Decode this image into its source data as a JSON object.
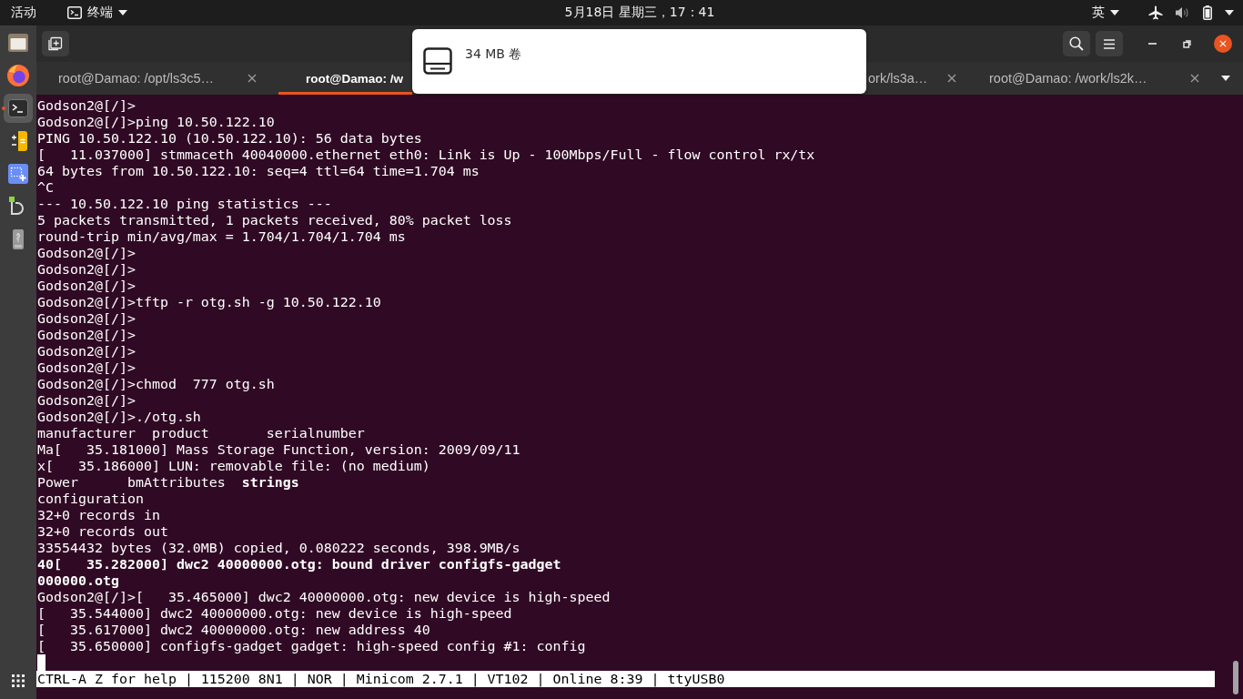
{
  "top_bar": {
    "activities": "活动",
    "app_menu": "终端",
    "clock": "5月18日 星期三，17：41",
    "input_method": "英"
  },
  "dock": {
    "items": [
      {
        "kind": "files",
        "running": false,
        "focused": false
      },
      {
        "kind": "browser",
        "running": false,
        "focused": false
      },
      {
        "kind": "terminal",
        "running": true,
        "focused": true
      },
      {
        "kind": "calculator",
        "running": false,
        "focused": false
      },
      {
        "kind": "screenshot",
        "running": false,
        "focused": false
      },
      {
        "kind": "hook",
        "running": false,
        "focused": false
      },
      {
        "kind": "drive",
        "running": false,
        "focused": false
      }
    ]
  },
  "window": {
    "tabs": [
      {
        "label": "root@Damao: /opt/ls3c5…",
        "selected": false,
        "closable": true
      },
      {
        "label": "root@Damao: /w",
        "selected": true,
        "closable": false
      },
      {
        "label": "ork/ls3a…",
        "selected": false,
        "closable": true
      },
      {
        "label": "root@Damao: /work/ls2k…",
        "selected": false,
        "closable": true
      }
    ]
  },
  "notification": {
    "label": "34 MB 卷"
  },
  "terminal": {
    "lines": [
      {
        "text": "Godson2@[/]>",
        "bold": false
      },
      {
        "text": "Godson2@[/]>ping 10.50.122.10",
        "bold": false
      },
      {
        "text": "PING 10.50.122.10 (10.50.122.10): 56 data bytes",
        "bold": false
      },
      {
        "text": "[   11.037000] stmmaceth 40040000.ethernet eth0: Link is Up - 100Mbps/Full - flow control rx/tx",
        "bold": false
      },
      {
        "text": "64 bytes from 10.50.122.10: seq=4 ttl=64 time=1.704 ms",
        "bold": false
      },
      {
        "text": "^C",
        "bold": false
      },
      {
        "text": "--- 10.50.122.10 ping statistics ---",
        "bold": false
      },
      {
        "text": "5 packets transmitted, 1 packets received, 80% packet loss",
        "bold": false
      },
      {
        "text": "round-trip min/avg/max = 1.704/1.704/1.704 ms",
        "bold": false
      },
      {
        "text": "Godson2@[/]>",
        "bold": false
      },
      {
        "text": "Godson2@[/]>",
        "bold": false
      },
      {
        "text": "Godson2@[/]>",
        "bold": false
      },
      {
        "text": "Godson2@[/]>tftp -r otg.sh -g 10.50.122.10",
        "bold": false
      },
      {
        "text": "Godson2@[/]>",
        "bold": false
      },
      {
        "text": "Godson2@[/]>",
        "bold": false
      },
      {
        "text": "Godson2@[/]>",
        "bold": false
      },
      {
        "text": "Godson2@[/]>",
        "bold": false
      },
      {
        "text": "Godson2@[/]>chmod  777 otg.sh",
        "bold": false
      },
      {
        "text": "Godson2@[/]>",
        "bold": false
      },
      {
        "text": "Godson2@[/]>./otg.sh",
        "bold": false
      },
      {
        "text": "manufacturer  product       serialnumber",
        "bold": false
      },
      {
        "text": "Ma[   35.181000] Mass Storage Function, version: 2009/09/11",
        "bold": false
      },
      {
        "text": "x[   35.186000] LUN: removable file: (no medium)",
        "bold": false
      },
      {
        "text": "Power      bmAttributes  **strings**",
        "bold": false
      },
      {
        "text": "configuration",
        "bold": false
      },
      {
        "text": "32+0 records in",
        "bold": false
      },
      {
        "text": "32+0 records out",
        "bold": false
      },
      {
        "text": "33554432 bytes (32.0MB) copied, 0.080222 seconds, 398.9MB/s",
        "bold": false
      },
      {
        "text": "40[   35.282000] dwc2 40000000.otg: bound driver configfs-gadget",
        "bold": true
      },
      {
        "text": "000000.otg",
        "bold": true
      },
      {
        "text": "Godson2@[/]>[   35.465000] dwc2 40000000.otg: new device is high-speed",
        "bold": false
      },
      {
        "text": "[   35.544000] dwc2 40000000.otg: new device is high-speed",
        "bold": false
      },
      {
        "text": "[   35.617000] dwc2 40000000.otg: new address 40",
        "bold": false
      },
      {
        "text": "[   35.650000] configfs-gadget gadget: high-speed config #1: config",
        "bold": false
      }
    ],
    "status_line": "CTRL-A Z for help | 115200 8N1 | NOR | Minicom 2.7.1 | VT102 | Online 8:39 | ttyUSB0"
  }
}
